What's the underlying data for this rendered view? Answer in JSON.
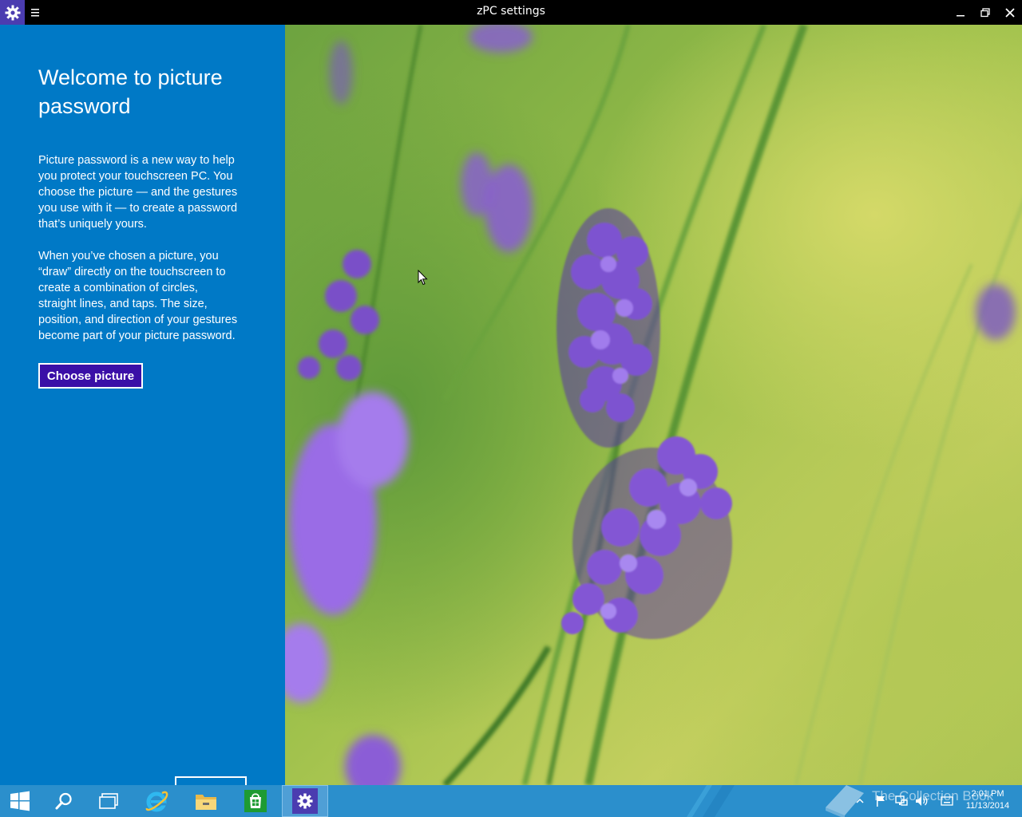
{
  "window": {
    "title": "zPC settings"
  },
  "panel": {
    "heading": "Welcome to picture password",
    "paragraph1": "Picture password is a new way to help you protect your touchscreen PC. You choose the picture — and the gestures you use with it — to create a password that’s uniquely yours.",
    "paragraph2": "When you’ve chosen a picture, you “draw” directly on the touchscreen to create a combination of circles, straight lines, and taps. The size, position, and direction of your gestures become part of your picture password.",
    "choose_button": "Choose picture"
  },
  "taskbar": {
    "apps": [
      "start-icon",
      "search-icon",
      "task-view-icon",
      "internet-explorer-icon",
      "file-explorer-icon",
      "store-icon",
      "settings-icon"
    ],
    "clock_time": "2:01 PM",
    "clock_date": "11/13/2014",
    "watermark": "The Collection Book"
  },
  "colors": {
    "panel_bg": "#0079c6",
    "button_bg": "#3a0fa7",
    "taskbar_bg": "#2b8fcc",
    "app_icon_bg": "#4b3cb0"
  }
}
